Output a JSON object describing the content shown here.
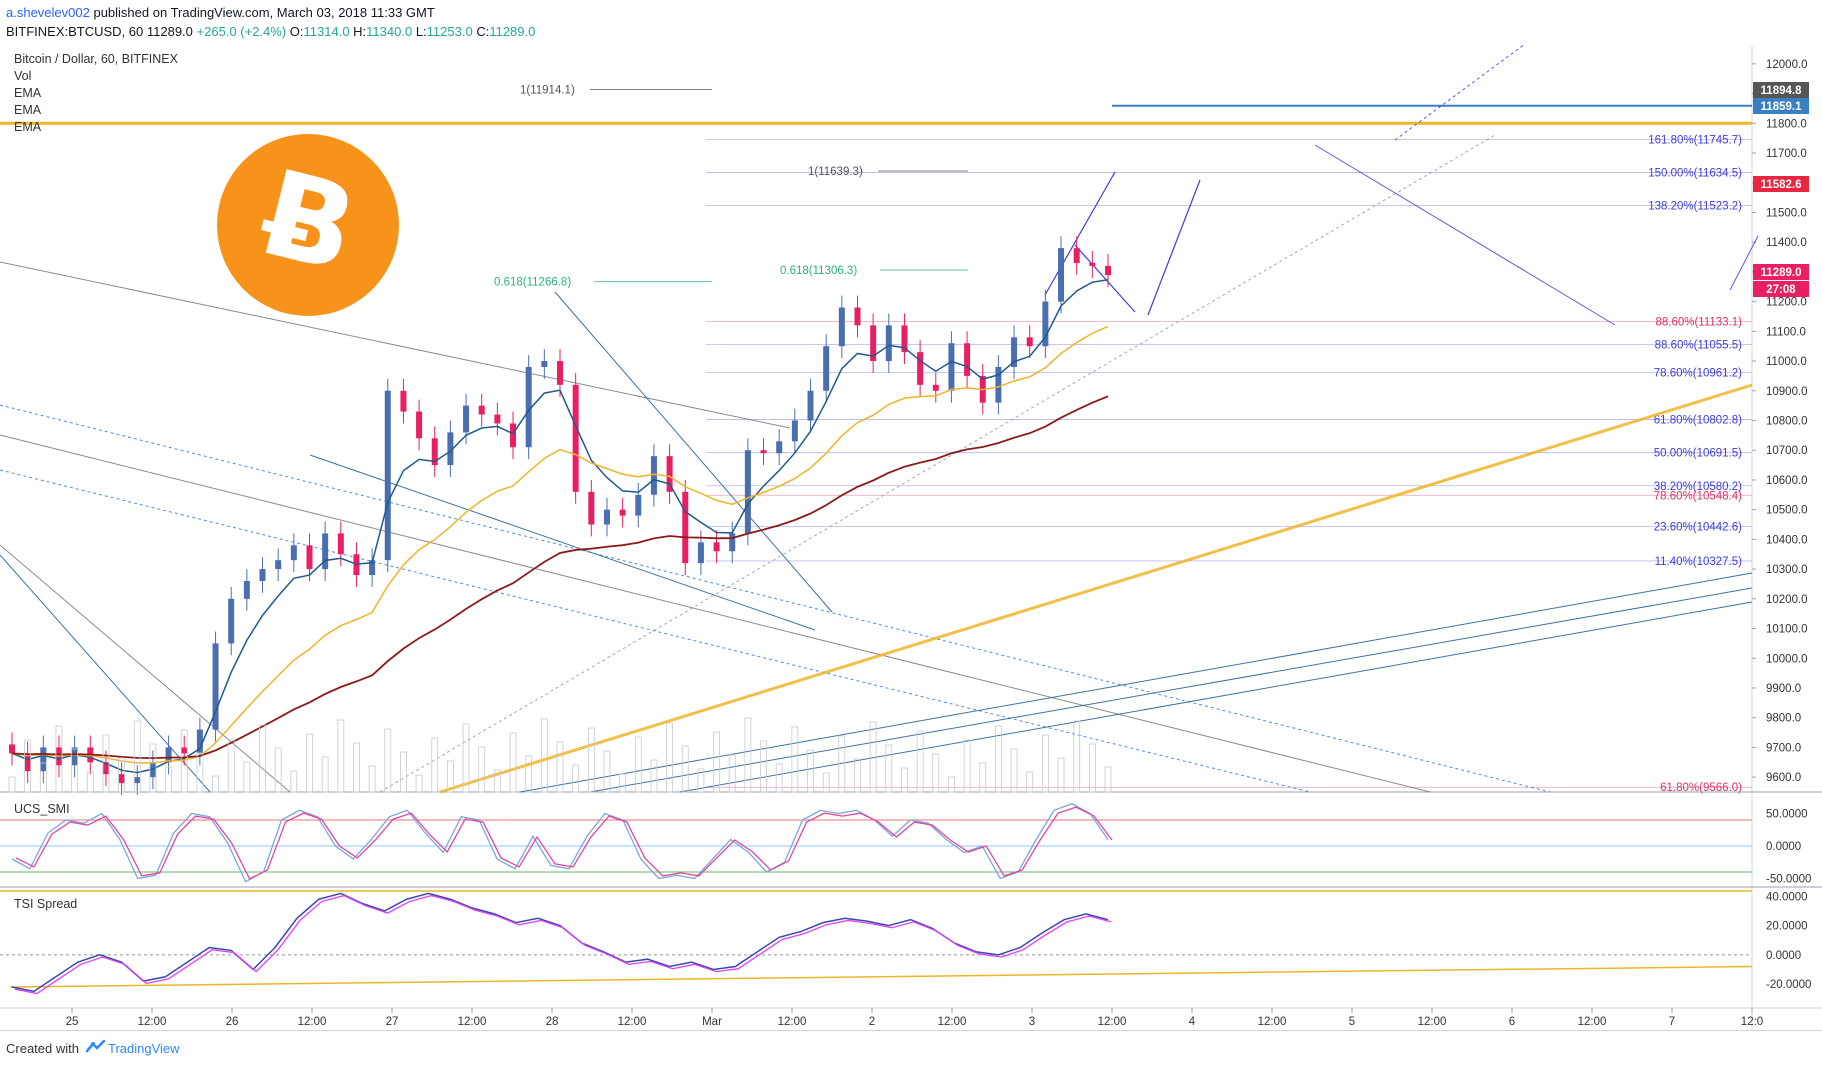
{
  "header": {
    "user": "a.shevelev002",
    "published": "published on TradingView.com, March 03, 2018 11:33 GMT",
    "symbol": "BITFINEX:BTCUSD, 60",
    "last": "11289.0",
    "change": "+265.0 (+2.4%)",
    "o_label": "O:",
    "o_val": "11314.0",
    "h_label": "H:",
    "h_val": "11340.0",
    "l_label": "L:",
    "l_val": "11253.0",
    "c_label": "C:",
    "c_val": "11289.0"
  },
  "legend": {
    "title": "Bitcoin / Dollar, 60, BITFINEX",
    "items": [
      "Vol",
      "EMA",
      "EMA",
      "EMA"
    ]
  },
  "panes": {
    "smi": "UCS_SMI",
    "tsi": "TSI Spread"
  },
  "footer": {
    "created": "Created with",
    "brand": "TradingView"
  },
  "colors": {
    "up": "#26a69a",
    "candle_up": "#4a6eb0",
    "candle_down": "#e91e63",
    "ema_fast": "#1f5a8a",
    "ema_mid": "#f0b429",
    "ema_slow": "#8b1a1a",
    "trend_gold": "#f0b429",
    "fib_blue": "#3d3dd6",
    "fib_pink": "#d6336c",
    "fib_green": "#2ab27b"
  },
  "chart_data": {
    "type": "candlestick",
    "symbol": "BTCUSD",
    "interval": "60",
    "ylim": [
      9550,
      12060
    ],
    "y_ticks": [
      9600,
      9700,
      9800,
      9900,
      10000,
      10100,
      10200,
      10300,
      10400,
      10500,
      10600,
      10700,
      10800,
      10900,
      11000,
      11100,
      11200,
      11300,
      11400,
      11500,
      11600,
      11700,
      11800,
      11900,
      12000
    ],
    "x_ticks": [
      "25",
      "12:00",
      "26",
      "12:00",
      "27",
      "12:00",
      "28",
      "12:00",
      "Mar",
      "12:00",
      "2",
      "12:00",
      "3",
      "12:00",
      "4",
      "12:00",
      "5",
      "12:00",
      "6",
      "12:00",
      "7",
      "12:0"
    ],
    "price_badges": [
      {
        "value": "11894.8",
        "color": "#555555"
      },
      {
        "value": "11859.1",
        "color": "#3a7fc1"
      },
      {
        "value": "11582.6",
        "color": "#e8263f"
      },
      {
        "value": "11289.0",
        "color": "#e91e63"
      },
      {
        "value": "27:08",
        "color": "#e91e63"
      }
    ],
    "fib_labels": [
      {
        "text": "161.80%(11745.7)",
        "price": 11745.7,
        "color": "#3d3dd6"
      },
      {
        "text": "150.00%(11634.5)",
        "price": 11634.5,
        "color": "#3d3dd6"
      },
      {
        "text": "138.20%(11523.2)",
        "price": 11523.2,
        "color": "#3d3dd6"
      },
      {
        "text": "88.60%(11133.1)",
        "price": 11133.1,
        "color": "#d6336c"
      },
      {
        "text": "88.60%(11055.5)",
        "price": 11055.5,
        "color": "#3d3dd6"
      },
      {
        "text": "78.60%(10961.2)",
        "price": 10961.2,
        "color": "#3d3dd6"
      },
      {
        "text": "61.80%(10802.8)",
        "price": 10802.8,
        "color": "#3d3dd6"
      },
      {
        "text": "50.00%(10691.5)",
        "price": 10691.5,
        "color": "#3d3dd6"
      },
      {
        "text": "38.20%(10580.2)",
        "price": 10580.2,
        "color": "#3d3dd6"
      },
      {
        "text": "78.60%(10548.4)",
        "price": 10548.4,
        "color": "#d6336c"
      },
      {
        "text": "23.60%(10442.6)",
        "price": 10442.6,
        "color": "#3d3dd6"
      },
      {
        "text": "11.40%(10327.5)",
        "price": 10327.5,
        "color": "#3d3dd6"
      },
      {
        "text": "61.80%(9566.0)",
        "price": 9566.0,
        "color": "#d6336c"
      }
    ],
    "annotations": [
      {
        "text": "1(11914.1)",
        "price": 11914.1,
        "color": "#555555"
      },
      {
        "text": "1(11639.3)",
        "price": 11639.3,
        "color": "#555555"
      },
      {
        "text": "0.618(11266.8)",
        "price": 11266.8,
        "color": "#2ab27b"
      },
      {
        "text": "0.618(11306.3)",
        "price": 11306.3,
        "color": "#2ab27b"
      }
    ],
    "horizontal_levels": [
      {
        "price": 11859.1,
        "color": "#3a7fc1"
      },
      {
        "price": 11800,
        "color": "#f0b429"
      }
    ],
    "close_path": [
      9680,
      9620,
      9700,
      9640,
      9700,
      9650,
      9610,
      9580,
      9600,
      9650,
      9700,
      9680,
      9760,
      10050,
      10200,
      10260,
      10300,
      10330,
      10380,
      10300,
      10420,
      10350,
      10280,
      10330,
      10900,
      10830,
      10740,
      10650,
      10760,
      10850,
      10820,
      10790,
      10710,
      10980,
      11000,
      10920,
      10560,
      10450,
      10500,
      10480,
      10550,
      10680,
      10560,
      10320,
      10390,
      10360,
      10420,
      10700,
      10690,
      10730,
      10800,
      10900,
      11050,
      11180,
      11120,
      11000,
      11120,
      11030,
      10920,
      10900,
      11060,
      10950,
      10860,
      10980,
      11080,
      11050,
      11200,
      11380,
      11330,
      11320,
      11289
    ],
    "smi": {
      "ylim": [
        -60,
        80
      ],
      "ticks": [
        "50.0000",
        "0.0000",
        "-50.0000"
      ],
      "upper": 40,
      "lower": -40,
      "values": [
        -20,
        -35,
        20,
        40,
        35,
        50,
        10,
        -50,
        -45,
        20,
        50,
        45,
        5,
        -55,
        -40,
        40,
        55,
        45,
        0,
        -20,
        10,
        45,
        55,
        20,
        -10,
        45,
        40,
        -20,
        -35,
        15,
        -30,
        -35,
        15,
        50,
        40,
        -20,
        -50,
        -45,
        -50,
        -20,
        10,
        -10,
        -40,
        -25,
        40,
        55,
        50,
        55,
        40,
        15,
        40,
        35,
        10,
        -10,
        0,
        -50,
        -40,
        10,
        55,
        65,
        50,
        10
      ]
    },
    "tsi": {
      "ylim": [
        -35,
        45
      ],
      "ticks": [
        "40.0000",
        "20.0000",
        "0.0000",
        "-20.0000"
      ],
      "values": [
        -22,
        -25,
        -15,
        -5,
        0,
        -5,
        -18,
        -15,
        -5,
        5,
        3,
        -10,
        5,
        25,
        38,
        42,
        35,
        30,
        38,
        42,
        38,
        32,
        28,
        22,
        25,
        20,
        8,
        2,
        -5,
        -3,
        -8,
        -5,
        -10,
        -8,
        2,
        12,
        16,
        22,
        25,
        23,
        20,
        24,
        18,
        8,
        2,
        0,
        5,
        15,
        24,
        28,
        24
      ]
    }
  }
}
